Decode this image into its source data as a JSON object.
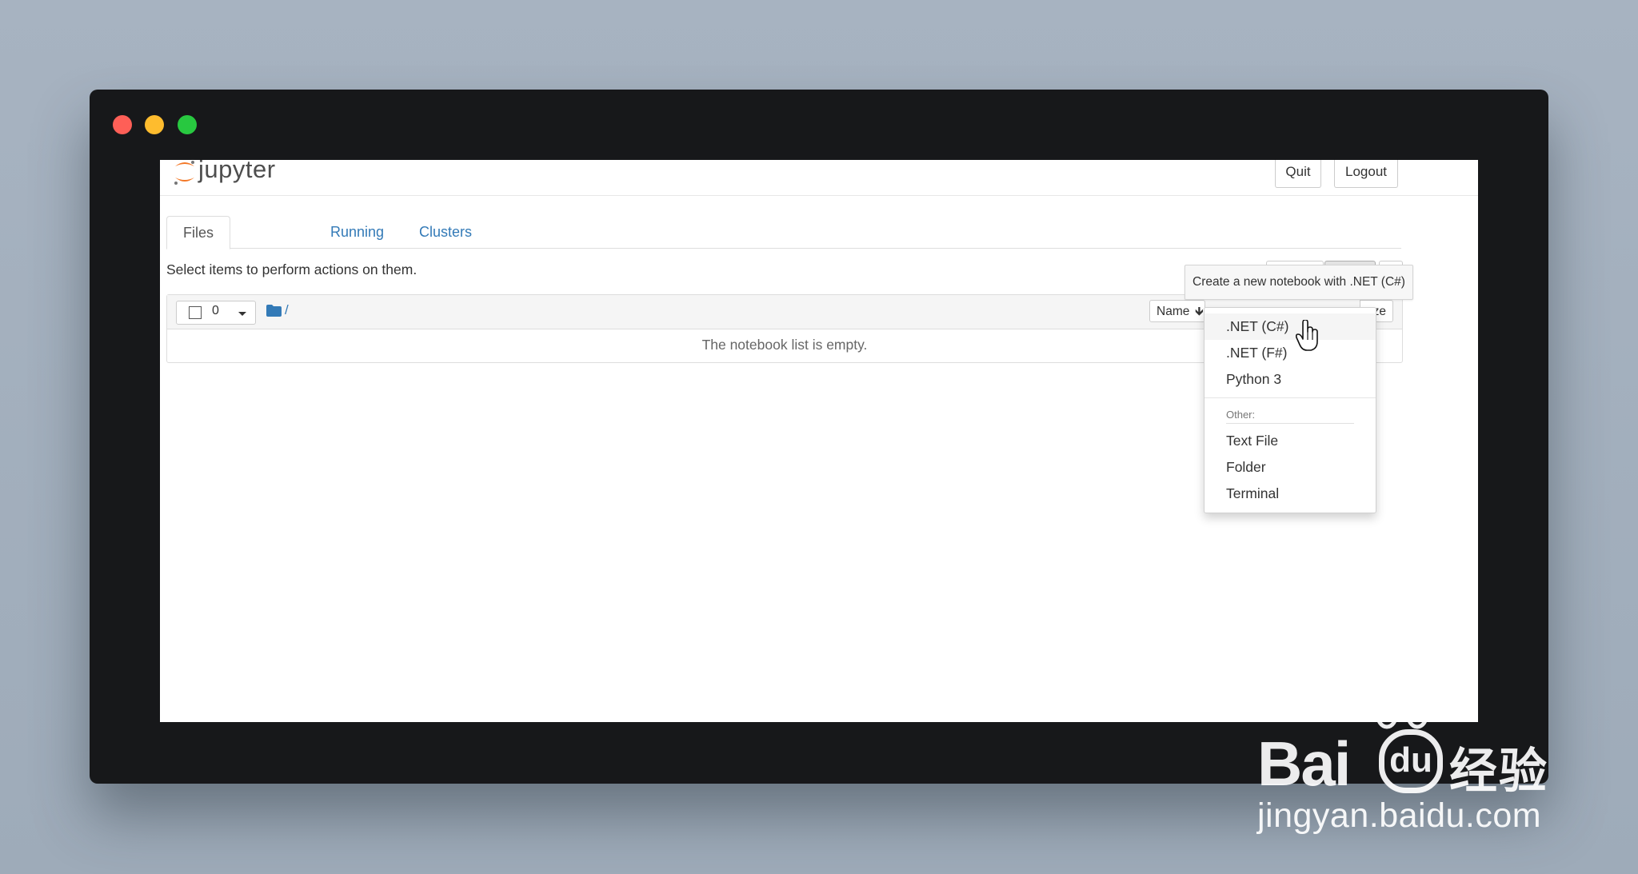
{
  "header": {
    "brand": "jupyter",
    "quit_label": "Quit",
    "logout_label": "Logout"
  },
  "tabs": [
    {
      "label": "Files",
      "active": true
    },
    {
      "label": "Running",
      "active": false
    },
    {
      "label": "Clusters",
      "active": false
    }
  ],
  "toolbar": {
    "instruction": "Select items to perform actions on them.",
    "selected_count": "0",
    "breadcrumb_root": "/",
    "sort_name_label": "Name",
    "sort_size_label": "ze"
  },
  "file_list": {
    "empty_message": "The notebook list is empty."
  },
  "tooltip": {
    "text": "Create a new notebook with .NET (C#)"
  },
  "new_menu": {
    "notebooks": [
      {
        "label": ".NET (C#)",
        "hovered": true
      },
      {
        "label": ".NET (F#)",
        "hovered": false
      },
      {
        "label": "Python 3",
        "hovered": false
      }
    ],
    "other_header": "Other:",
    "other": [
      {
        "label": "Text File"
      },
      {
        "label": "Folder"
      },
      {
        "label": "Terminal"
      }
    ]
  },
  "watermark": {
    "bai": "Bai",
    "du": "du",
    "jingyan": "经验",
    "url": "jingyan.baidu.com"
  },
  "colors": {
    "link": "#337ab7",
    "jupyter_orange": "#f37726",
    "window_frame": "#17181a"
  },
  "icons": {
    "folder": "folder-icon",
    "caret": "caret-down-icon",
    "sort": "arrow-down-icon",
    "cursor": "hand-pointer-icon"
  }
}
